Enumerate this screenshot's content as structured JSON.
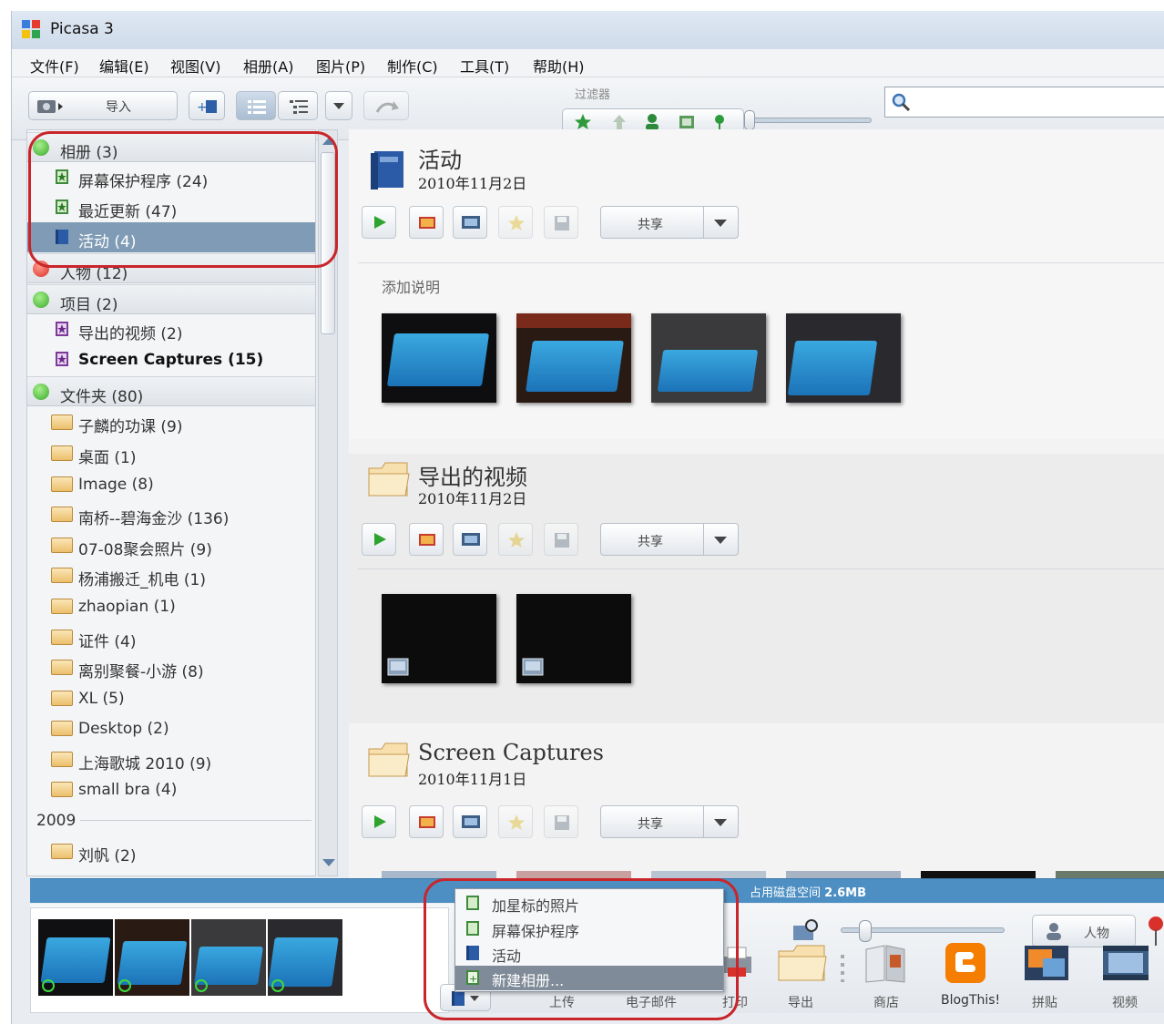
{
  "window": {
    "title": "Picasa 3"
  },
  "menu": [
    "文件(F)",
    "编辑(E)",
    "视图(V)",
    "相册(A)",
    "图片(P)",
    "制作(C)",
    "工具(T)",
    "帮助(H)"
  ],
  "toolbar": {
    "import_label": "导入",
    "filter_label": "过滤器"
  },
  "sidebar": {
    "albums": {
      "header": "相册 (3)",
      "items": [
        "屏幕保护程序 (24)",
        "最近更新 (47)",
        "活动 (4)"
      ]
    },
    "people": {
      "header": "人物 (12)"
    },
    "projects": {
      "header": "项目 (2)",
      "items": [
        "导出的视频 (2)",
        "Screen Captures (15)"
      ]
    },
    "folders": {
      "header": "文件夹 (80)",
      "items": [
        "子麟的功课 (9)",
        "桌面 (1)",
        "Image (8)",
        "南桥--碧海金沙 (136)",
        "07-08聚会照片 (9)",
        "杨浦搬迁_机电 (1)",
        "zhaopian (1)",
        "证件 (4)",
        "离别聚餐-小游 (8)",
        "XL (5)",
        "Desktop (2)",
        "上海歌城 2010 (9)",
        "small bra (4)"
      ]
    },
    "year": "2009",
    "after_year": [
      "刘帆 (2)"
    ]
  },
  "sections": [
    {
      "title": "活动",
      "date": "2010年11月2日",
      "share": "共享",
      "caption": "添加说明"
    },
    {
      "title": "导出的视频",
      "date": "2010年11月2日",
      "share": "共享"
    },
    {
      "title": "Screen Captures",
      "date": "2010年11月1日",
      "share": "共享"
    }
  ],
  "status": {
    "prefix": "占用磁盘空间",
    "size": "2.6MB"
  },
  "popup": [
    "加星标的照片",
    "屏幕保护程序",
    "活动",
    "新建相册..."
  ],
  "tray": {
    "people_button": "人物",
    "actions": [
      "上传",
      "电子邮件",
      "打印",
      "导出",
      "商店",
      "BlogThis!",
      "拼贴",
      "视频"
    ]
  },
  "colors": {
    "selection": "#7f9bb5",
    "status_bar": "#4d8fc3",
    "annotation": "#c8262b"
  }
}
